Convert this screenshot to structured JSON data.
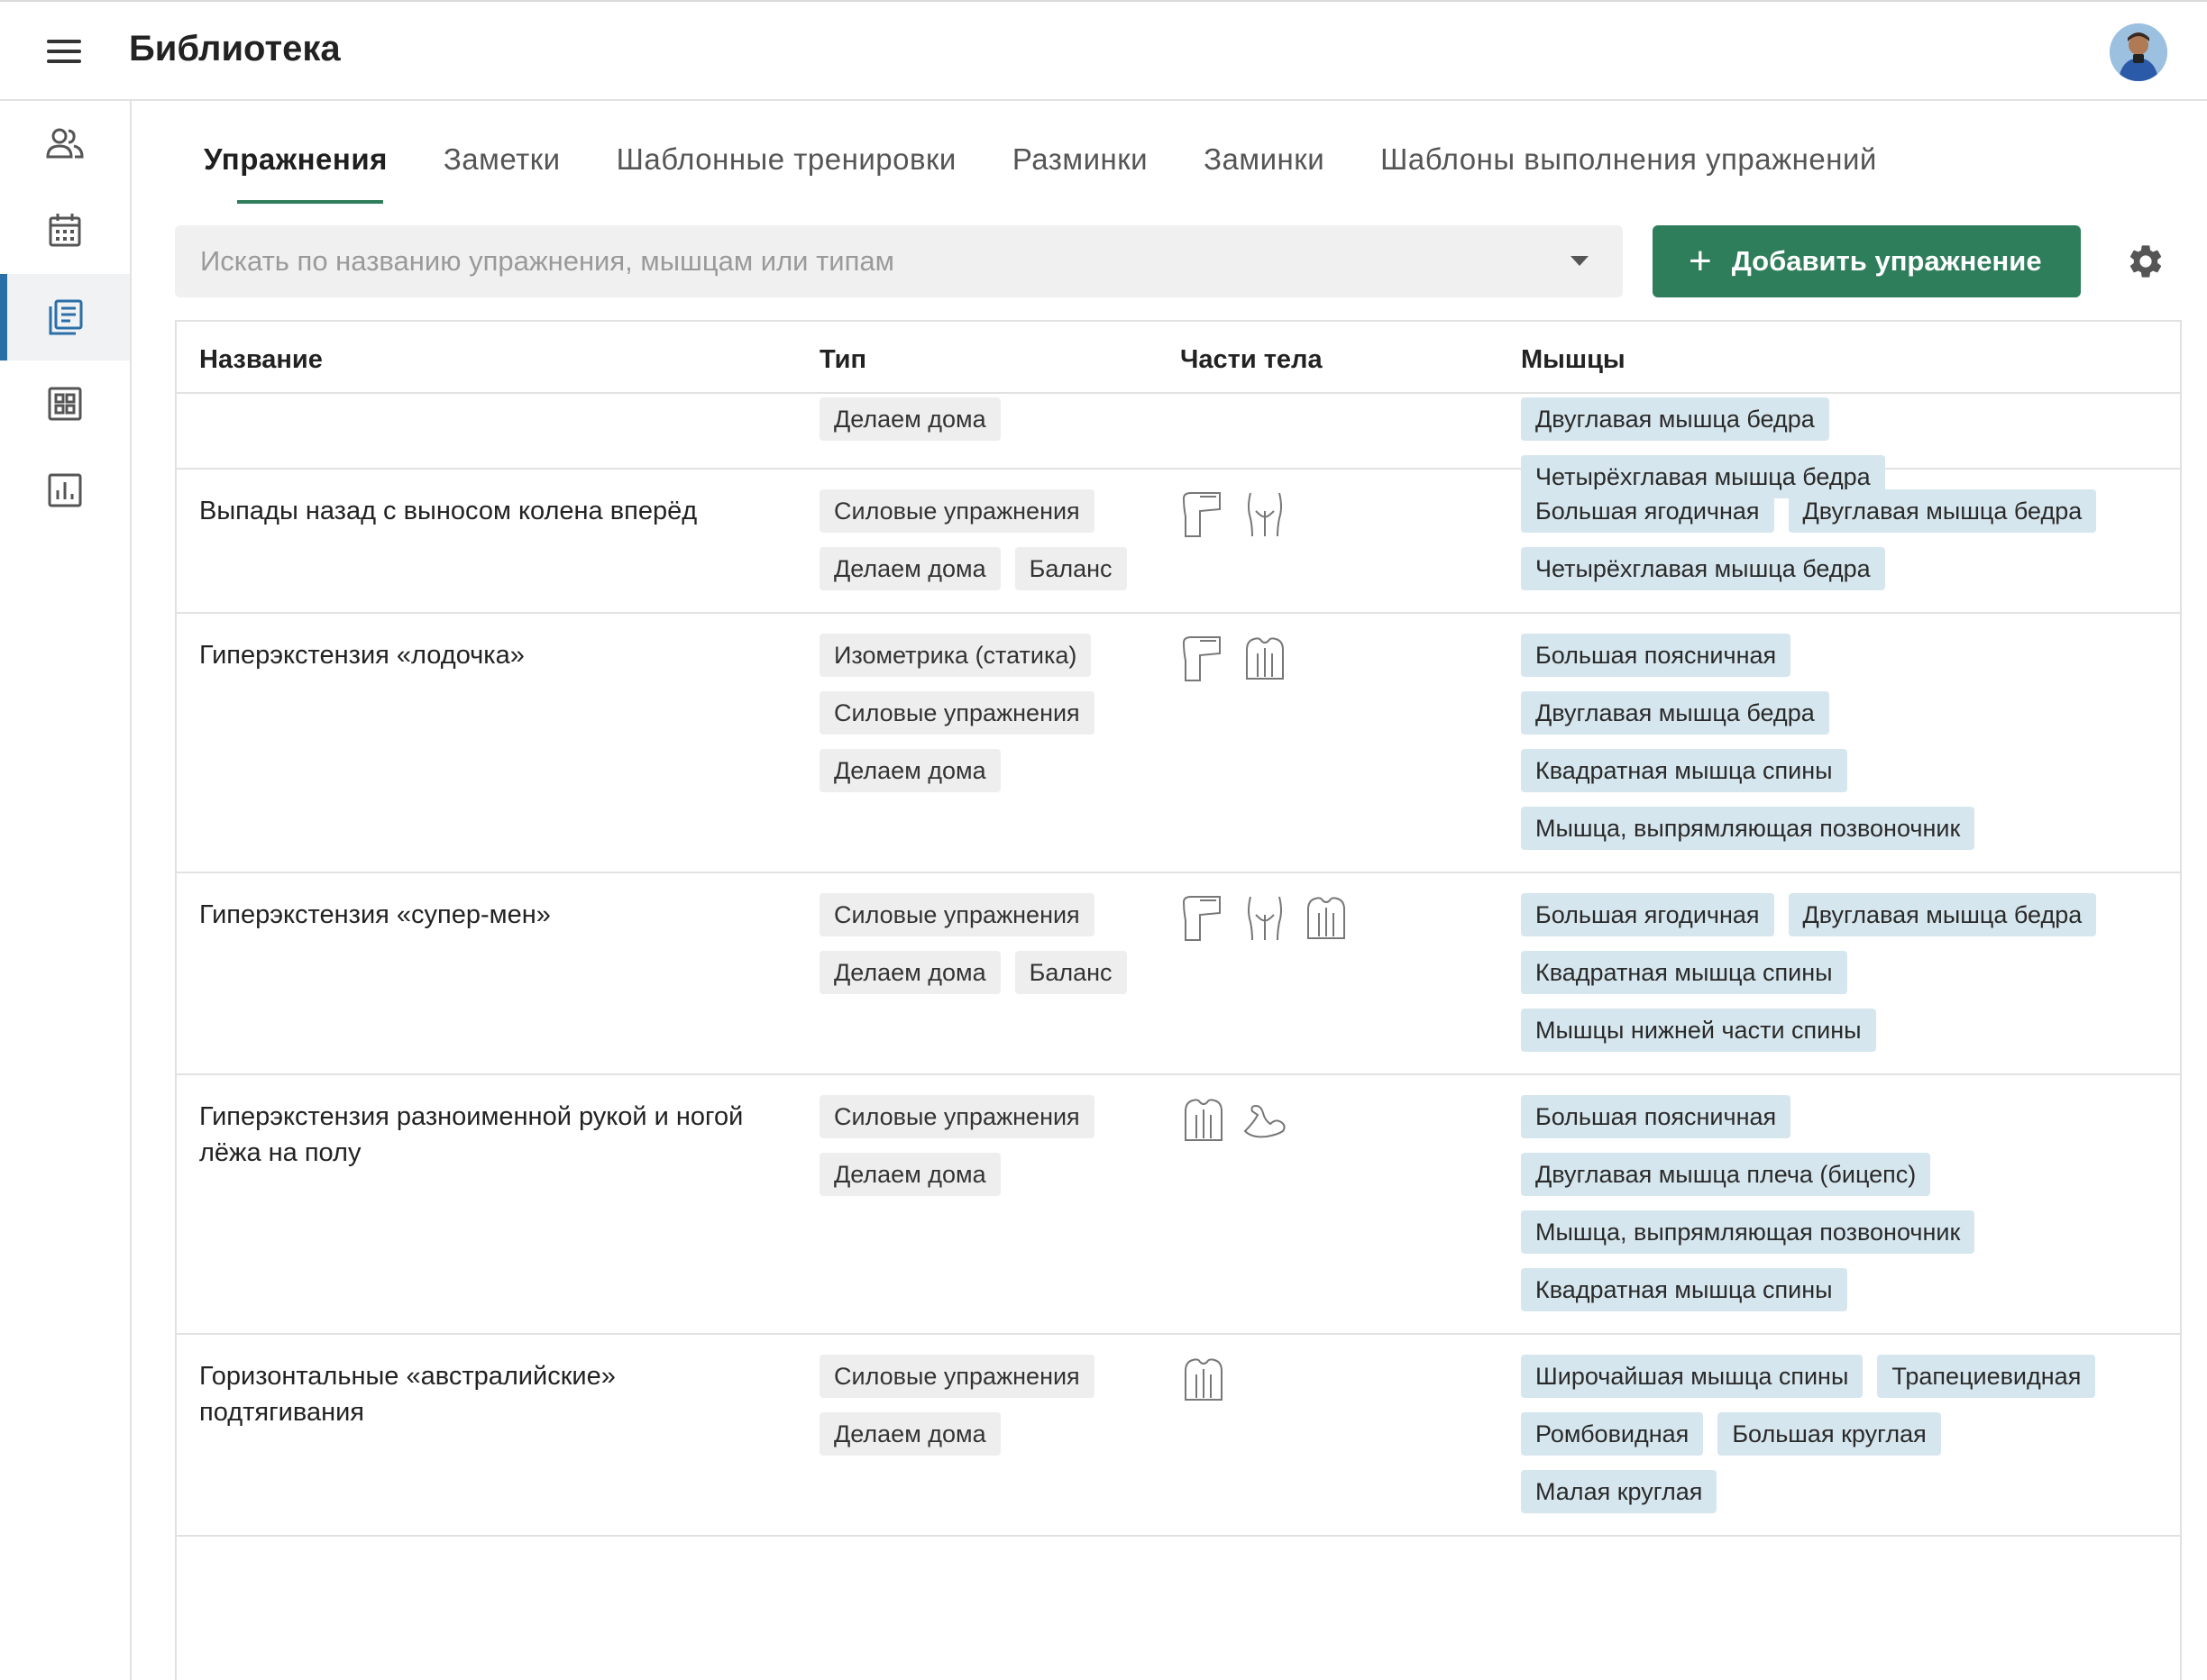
{
  "header": {
    "title": "Библиотека",
    "menu_icon": "hamburger-menu-icon",
    "avatar": "user-avatar"
  },
  "sidebar": {
    "items": [
      {
        "icon": "users-icon"
      },
      {
        "icon": "calendar-icon"
      },
      {
        "icon": "library-icon",
        "active": true
      },
      {
        "icon": "grid-icon"
      },
      {
        "icon": "chart-icon"
      }
    ]
  },
  "tabs": [
    {
      "label": "Упражнения",
      "active": true
    },
    {
      "label": "Заметки"
    },
    {
      "label": "Шаблонные тренировки"
    },
    {
      "label": "Разминки"
    },
    {
      "label": "Заминки"
    },
    {
      "label": "Шаблоны выполнения упражнений"
    }
  ],
  "search": {
    "placeholder": "Искать по названию упражнения, мышцам или типам"
  },
  "add_button": {
    "label": "Добавить упражнение"
  },
  "columns": {
    "name": "Название",
    "type": "Тип",
    "parts": "Части тела",
    "muscles": "Мышцы"
  },
  "colors": {
    "accent": "#2e7d5b",
    "heart": "#5bb585",
    "muscle_chip": "#d6e6ee",
    "type_chip": "#eeeeee"
  },
  "rows": [
    {
      "name": "",
      "types": [
        "Делаем дома"
      ],
      "parts": [],
      "muscles": [
        "Двуглавая мышца бедра",
        "Четырёхглавая мышца бедра"
      ],
      "favorite": null
    },
    {
      "name": "Выпады назад с выносом колена вперёд",
      "types": [
        "Силовые упражнения",
        "Делаем дома",
        "Баланс"
      ],
      "parts": [
        "leg-icon",
        "glutes-icon"
      ],
      "muscles": [
        "Большая ягодичная",
        "Двуглавая мышца бедра",
        "Четырёхглавая мышца бедра"
      ],
      "favorite": false
    },
    {
      "name": "Гиперэкстензия «лодочка»",
      "types": [
        "Изометрика (статика)",
        "Силовые упражнения",
        "Делаем дома"
      ],
      "parts": [
        "leg-icon",
        "back-icon"
      ],
      "muscles": [
        "Большая поясничная",
        "Двуглавая мышца бедра",
        "Квадратная мышца спины",
        "Мышца, выпрямляющая позвоночник"
      ],
      "favorite": true
    },
    {
      "name": "Гиперэкстензия «супер-мен»",
      "types": [
        "Силовые упражнения",
        "Делаем дома",
        "Баланс"
      ],
      "parts": [
        "leg-icon",
        "glutes-icon",
        "back-icon"
      ],
      "muscles": [
        "Большая ягодичная",
        "Двуглавая мышца бедра",
        "Квадратная мышца спины",
        "Мышцы нижней части спины"
      ],
      "favorite": false
    },
    {
      "name": "Гиперэкстензия разноименной рукой и ногой лёжа на полу",
      "types": [
        "Силовые упражнения",
        "Делаем дома"
      ],
      "parts": [
        "back-icon",
        "arm-icon"
      ],
      "muscles": [
        "Большая поясничная",
        "Двуглавая мышца плеча (бицепс)",
        "Мышца, выпрямляющая позвоночник",
        "Квадратная мышца спины"
      ],
      "favorite": false
    },
    {
      "name": "Горизонтальные «австралийские» подтягивания",
      "types": [
        "Силовые упражнения",
        "Делаем дома"
      ],
      "parts": [
        "back-icon"
      ],
      "muscles": [
        "Широчайшая мышца спины",
        "Трапециевидная",
        "Ромбовидная",
        "Большая круглая",
        "Малая круглая"
      ],
      "favorite": false
    }
  ]
}
